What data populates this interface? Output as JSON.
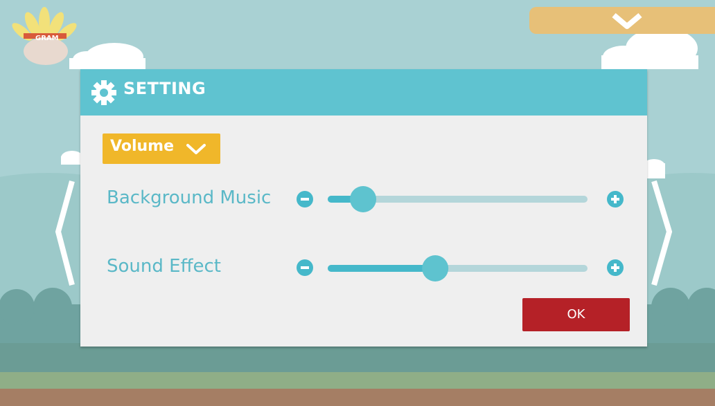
{
  "colors": {
    "sky": "#a9d1d3",
    "panel_header": "#5fc3d0",
    "panel_body": "#efefef",
    "accent_text": "#5ab8c7",
    "volume_button": "#f0b72a",
    "ok_button": "#b52127",
    "slider_track": "#b4d6da",
    "slider_fill": "#45b8ca",
    "grass": "#8fae87",
    "ground": "#a57e64",
    "top_tab": "#e7c078"
  },
  "logo": {
    "text": "GRAM"
  },
  "settings": {
    "title": "SETTING",
    "title_icon": "gear-icon",
    "volume_menu": {
      "label": "Volume",
      "icon": "chevron-down-icon"
    },
    "sliders": [
      {
        "label": "Background Music",
        "value": 0.12
      },
      {
        "label": "Sound Effect",
        "value": 0.41
      }
    ],
    "ok_label": "OK"
  },
  "top_tab": {
    "icon": "chevron-down-icon"
  }
}
